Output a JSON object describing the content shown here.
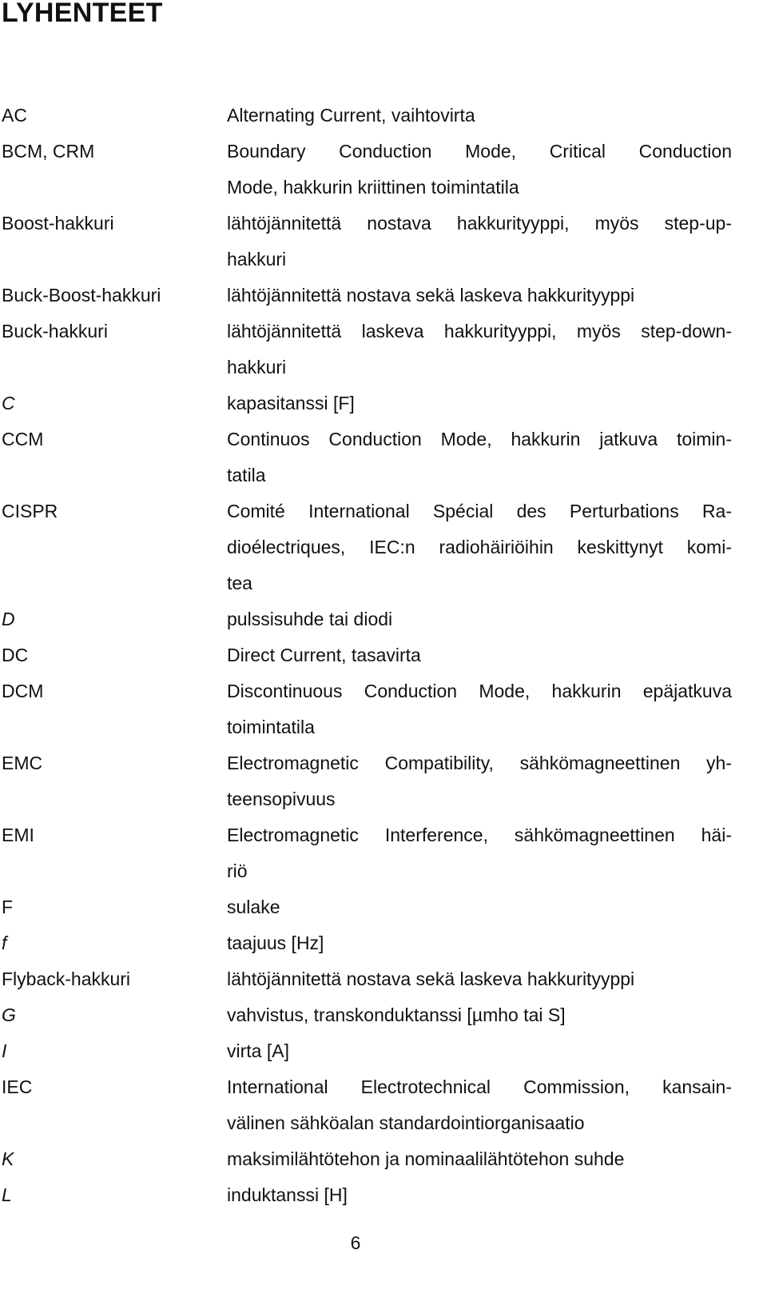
{
  "document": {
    "title": "LYHENTEET",
    "page_number": "6",
    "entries": [
      {
        "term": "AC",
        "italic": false,
        "lines": [
          "Alternating Current, vaihtovirta"
        ]
      },
      {
        "term": "BCM, CRM",
        "italic": false,
        "lines": [
          "Boundary Conduction Mode, Critical Conduction",
          "Mode, hakkurin kriittinen toimintatila"
        ]
      },
      {
        "term": "Boost-hakkuri",
        "italic": false,
        "lines": [
          "lähtöjännitettä nostava hakkurityyppi, myös step-up-",
          "hakkuri"
        ]
      },
      {
        "term": "Buck-Boost-hakkuri",
        "italic": false,
        "lines": [
          "lähtöjännitettä nostava sekä laskeva hakkurityyppi"
        ]
      },
      {
        "term": "Buck-hakkuri",
        "italic": false,
        "lines": [
          "lähtöjännitettä laskeva hakkurityyppi, myös step-down-",
          "hakkuri"
        ]
      },
      {
        "term": "C",
        "italic": true,
        "lines": [
          "kapasitanssi [F]"
        ]
      },
      {
        "term": "CCM",
        "italic": false,
        "lines": [
          "Continuos Conduction Mode, hakkurin jatkuva toimin-",
          "tatila"
        ]
      },
      {
        "term": "CISPR",
        "italic": false,
        "lines": [
          "Comité International Spécial des Perturbations Ra-",
          "dioélectriques, IEC:n radiohäiriöihin keskittynyt komi-",
          "tea"
        ]
      },
      {
        "term": "D",
        "italic": true,
        "lines": [
          "pulssisuhde tai diodi"
        ]
      },
      {
        "term": "DC",
        "italic": false,
        "lines": [
          "Direct Current, tasavirta"
        ]
      },
      {
        "term": "DCM",
        "italic": false,
        "lines": [
          "Discontinuous Conduction Mode, hakkurin epäjatkuva",
          "toimintatila"
        ]
      },
      {
        "term": "EMC",
        "italic": false,
        "lines": [
          "Electromagnetic Compatibility, sähkömagneettinen yh-",
          "teensopivuus"
        ]
      },
      {
        "term": "EMI",
        "italic": false,
        "lines": [
          "Electromagnetic Interference, sähkömagneettinen häi-",
          "riö"
        ]
      },
      {
        "term": "F",
        "italic": false,
        "lines": [
          "sulake"
        ]
      },
      {
        "term": "f",
        "italic": true,
        "lines": [
          "taajuus [Hz]"
        ]
      },
      {
        "term": "Flyback-hakkuri",
        "italic": false,
        "lines": [
          "lähtöjännitettä nostava sekä laskeva hakkurityyppi"
        ]
      },
      {
        "term": "G",
        "italic": true,
        "lines": [
          "vahvistus, transkonduktanssi [µmho tai S]"
        ]
      },
      {
        "term": "I",
        "italic": true,
        "lines": [
          "virta [A]"
        ]
      },
      {
        "term": "IEC",
        "italic": false,
        "lines": [
          "International Electrotechnical Commission, kansain-",
          "välinen sähköalan standardointiorganisaatio"
        ]
      },
      {
        "term": "K",
        "italic": true,
        "lines": [
          "maksimilähtötehon ja nominaalilähtötehon suhde"
        ]
      },
      {
        "term": "L",
        "italic": true,
        "lines": [
          "induktanssi [H]"
        ]
      }
    ]
  }
}
